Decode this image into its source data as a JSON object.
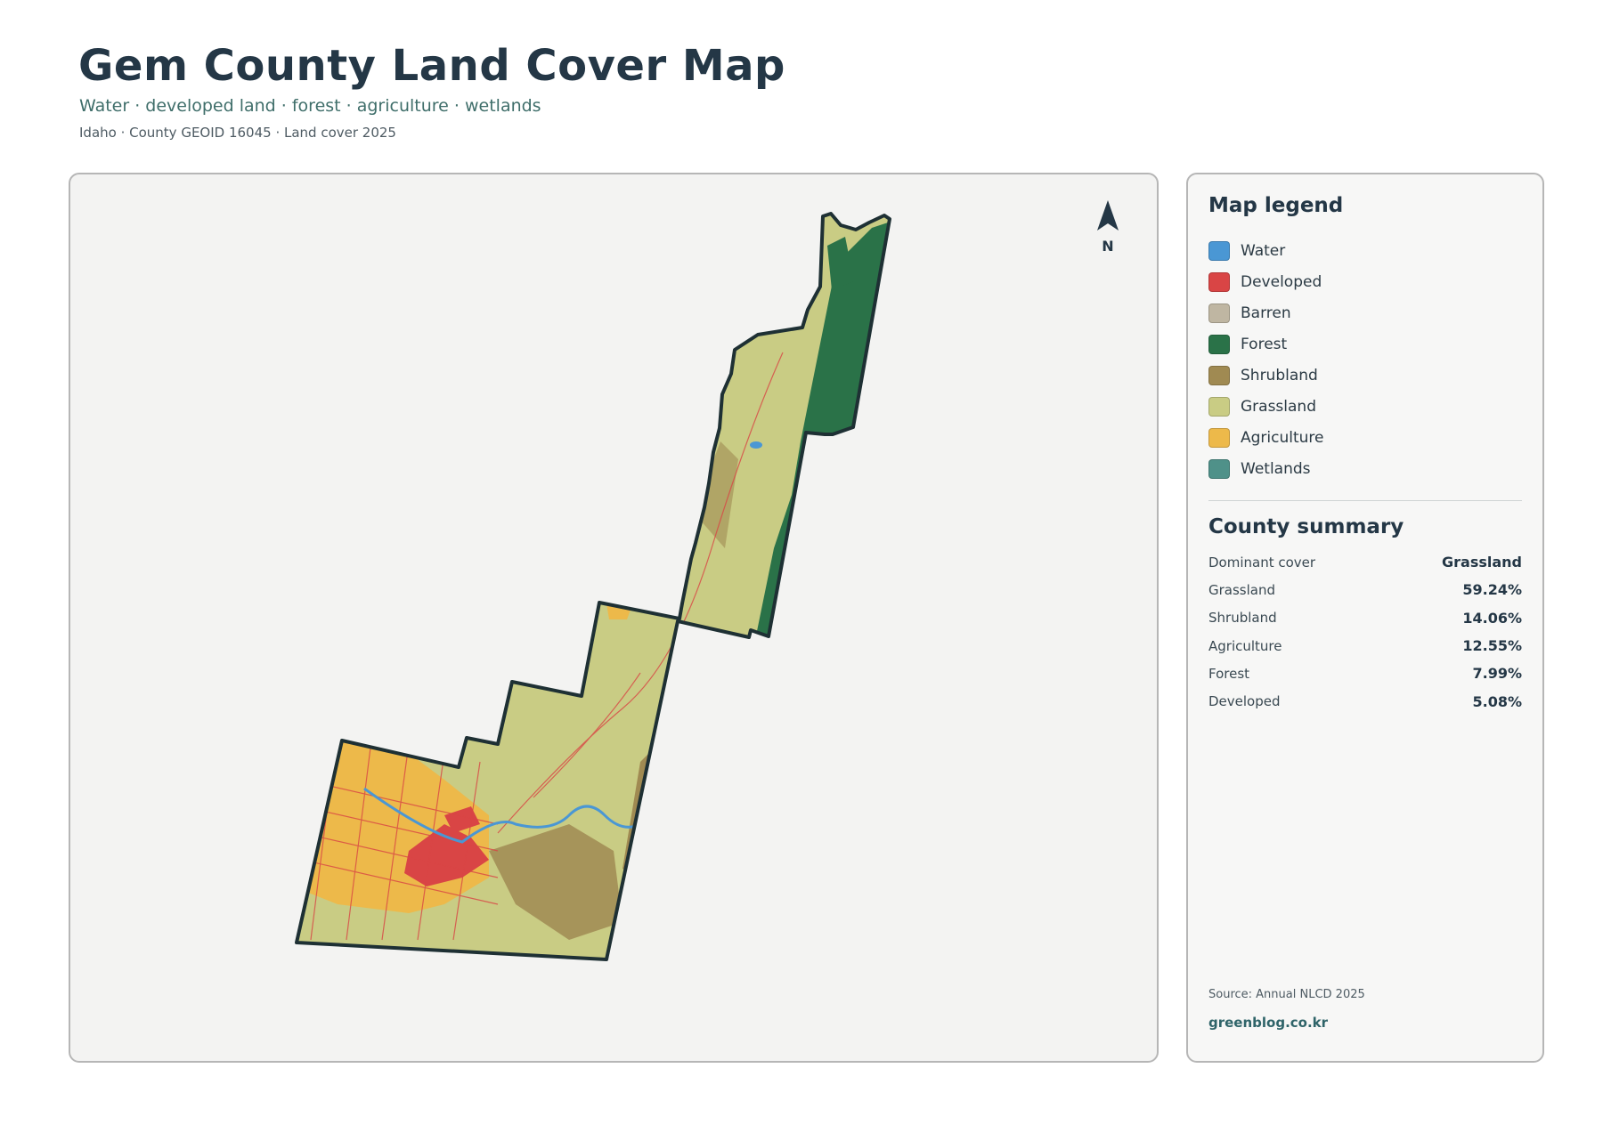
{
  "header": {
    "title": "Gem County Land Cover Map",
    "subtitle": "Water · developed land · forest · agriculture · wetlands",
    "meta": "Idaho · County GEOID 16045 · Land cover 2025"
  },
  "map": {
    "north_label": "N",
    "colors": {
      "water": "#4a97d4",
      "developed": "#d94545",
      "barren": "#bfb6a2",
      "forest": "#2a7248",
      "shrubland": "#a08a52",
      "grassland": "#c9cc84",
      "agriculture": "#edb94a",
      "wetlands": "#4f9189",
      "outline": "#1e3034",
      "background": "#f3f3f2"
    }
  },
  "legend": {
    "title": "Map legend",
    "items": [
      {
        "label": "Water",
        "color": "#4a97d4"
      },
      {
        "label": "Developed",
        "color": "#d94545"
      },
      {
        "label": "Barren",
        "color": "#bfb6a2"
      },
      {
        "label": "Forest",
        "color": "#2a7248"
      },
      {
        "label": "Shrubland",
        "color": "#a08a52"
      },
      {
        "label": "Grassland",
        "color": "#c9cc84"
      },
      {
        "label": "Agriculture",
        "color": "#edb94a"
      },
      {
        "label": "Wetlands",
        "color": "#4f9189"
      }
    ]
  },
  "summary": {
    "title": "County summary",
    "rows": [
      {
        "label": "Dominant cover",
        "value": "Grassland"
      },
      {
        "label": "Grassland",
        "value": "59.24%"
      },
      {
        "label": "Shrubland",
        "value": "14.06%"
      },
      {
        "label": "Agriculture",
        "value": "12.55%"
      },
      {
        "label": "Forest",
        "value": "7.99%"
      },
      {
        "label": "Developed",
        "value": "5.08%"
      }
    ]
  },
  "footer": {
    "source": "Source: Annual NLCD 2025",
    "site": "greenblog.co.kr"
  }
}
